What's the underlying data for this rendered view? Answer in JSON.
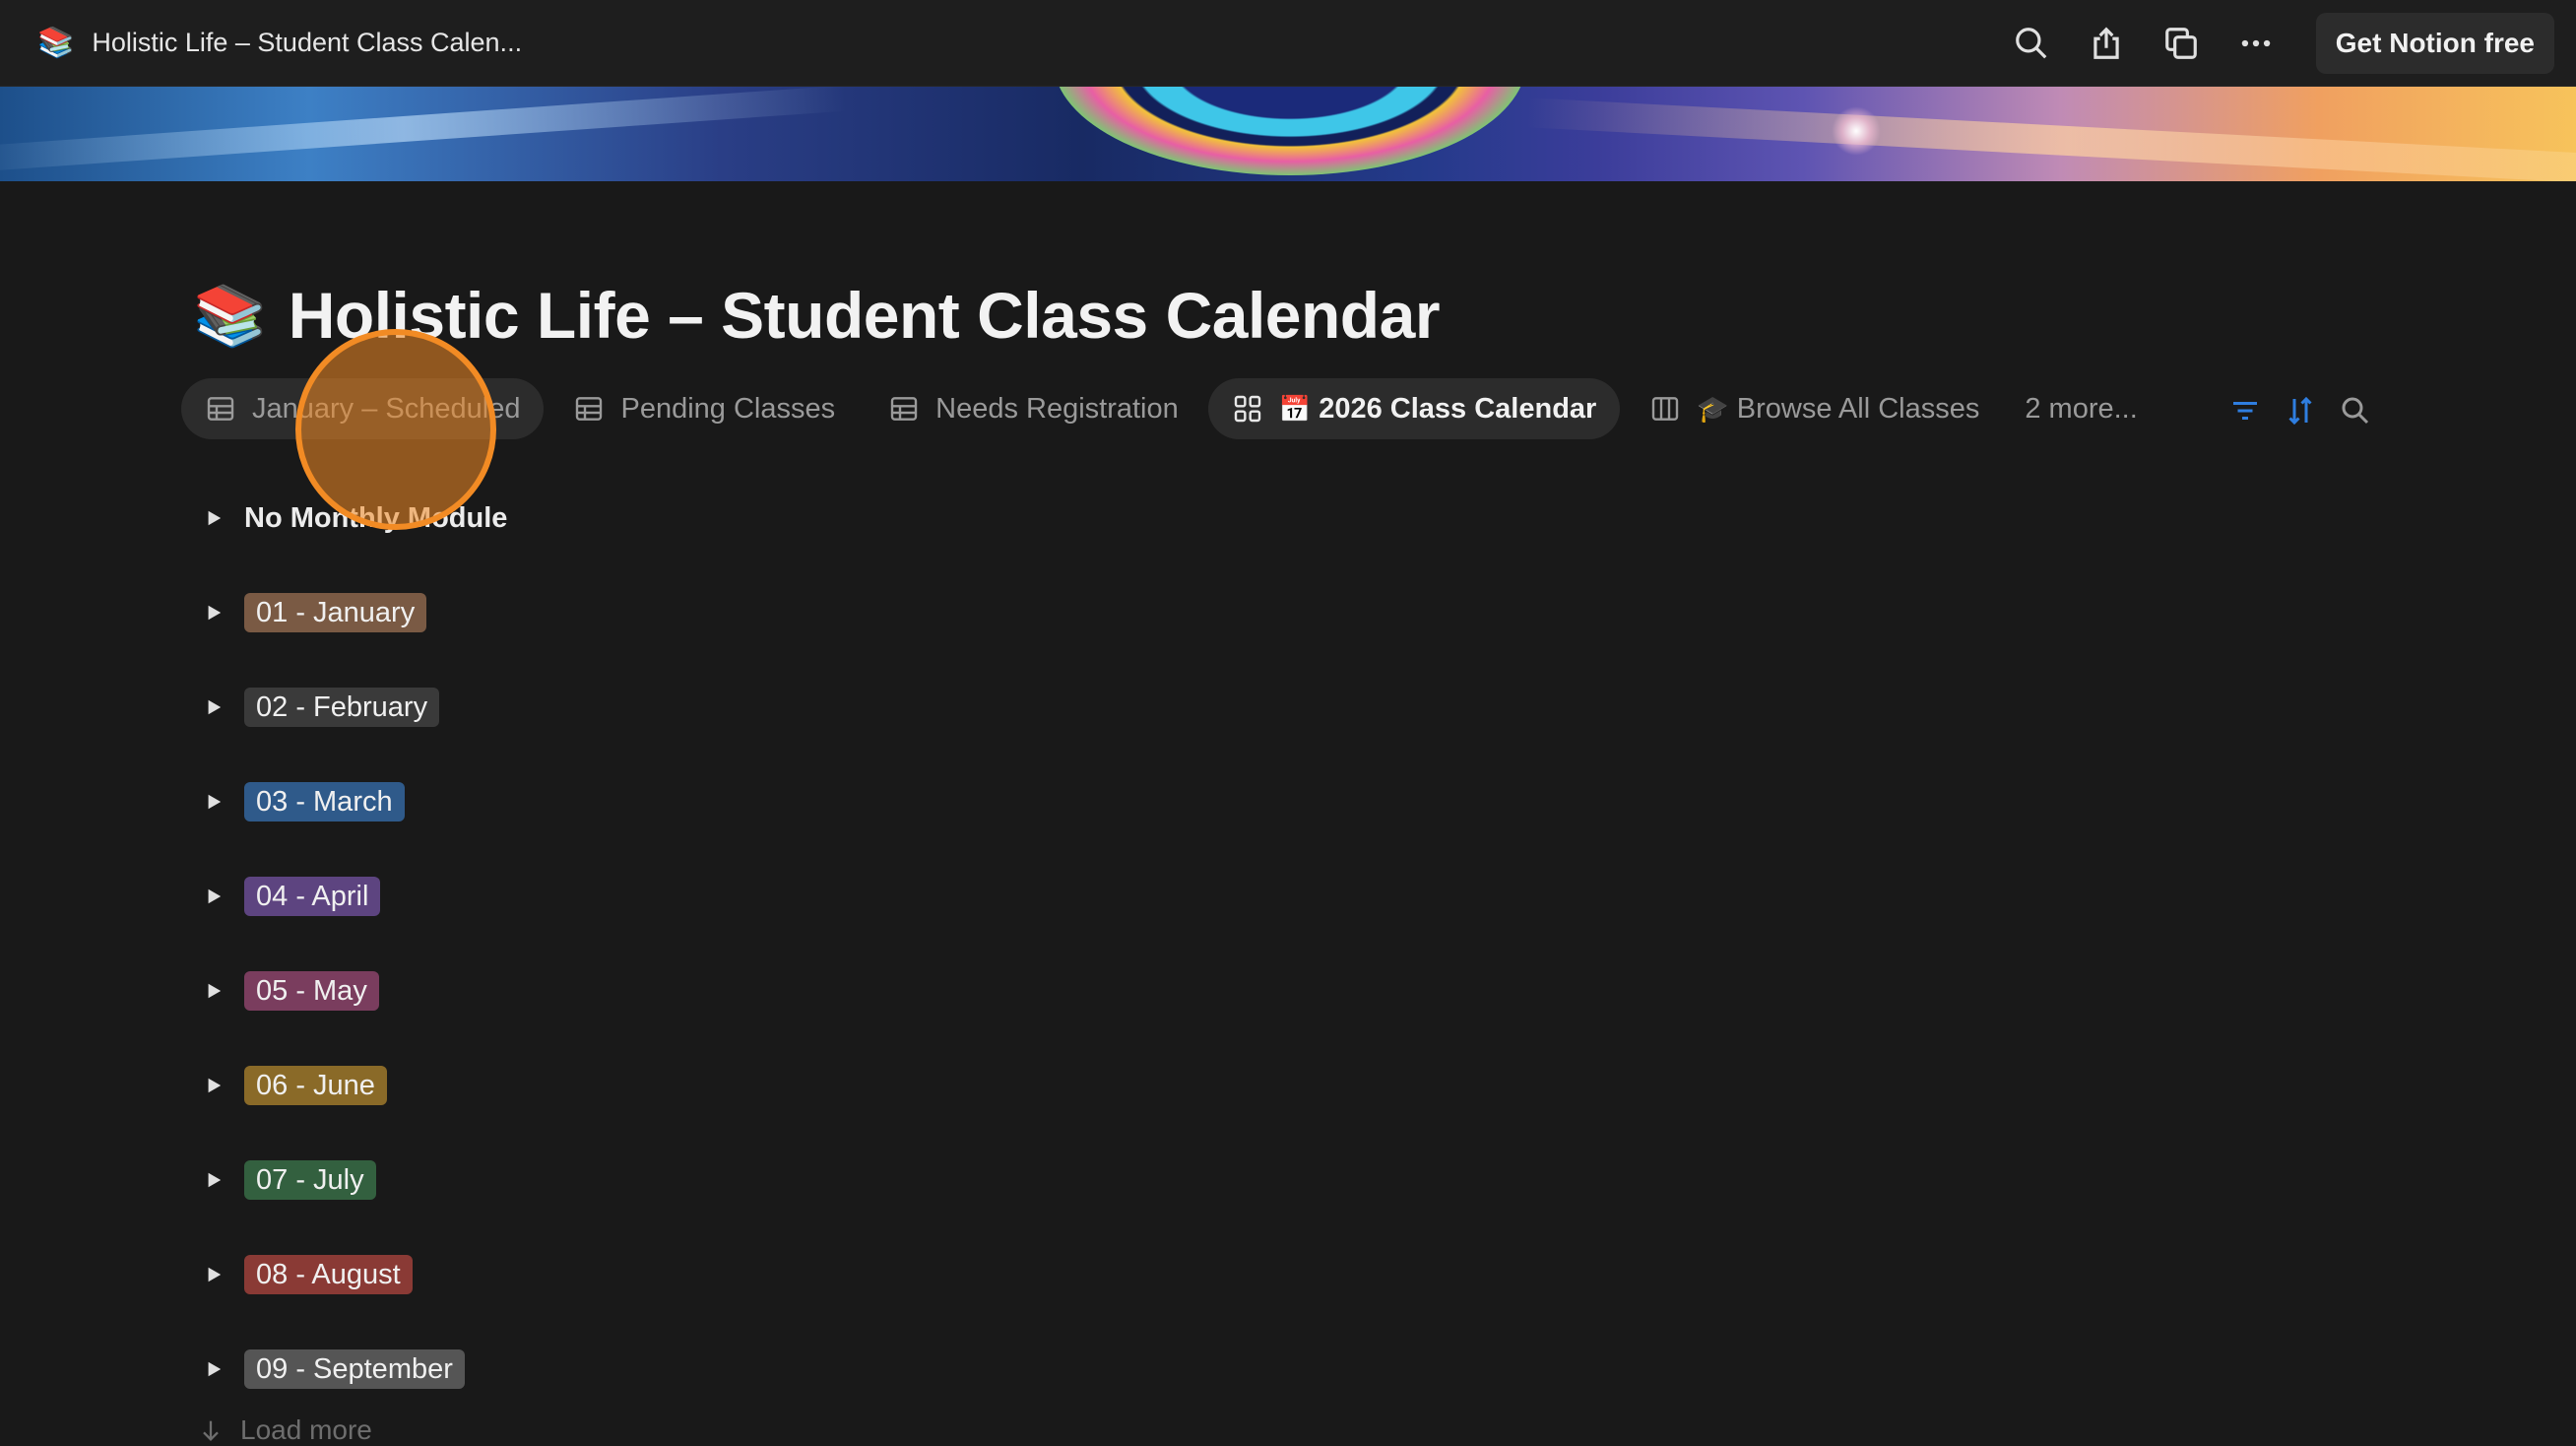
{
  "topbar": {
    "page_emoji": "📚",
    "page_title": "Holistic Life – Student Class Calen...",
    "get_notion_label": "Get Notion free",
    "icons": [
      "search-icon",
      "share-icon",
      "duplicate-icon",
      "more-icon"
    ]
  },
  "page": {
    "emoji": "📚",
    "title": "Holistic Life – Student Class Calendar"
  },
  "tabs": [
    {
      "label": "January – Scheduled",
      "icon": "table-icon"
    },
    {
      "label": "Pending Classes",
      "icon": "table-icon"
    },
    {
      "label": "Needs Registration",
      "icon": "table-icon"
    },
    {
      "label": "2026 Class Calendar",
      "icon": "gallery-icon",
      "emoji": "📅"
    },
    {
      "label": "Browse All Classes",
      "icon": "board-icon",
      "emoji": "🎓"
    },
    {
      "label": "2 more..."
    }
  ],
  "view_tools": [
    "filter-icon",
    "sort-icon",
    "search-icon"
  ],
  "groups": [
    {
      "label": "No Monthly Module",
      "color": ""
    },
    {
      "label": "01 - January",
      "color": "#7a5a44"
    },
    {
      "label": "02 - February",
      "color": "#3a3a3a"
    },
    {
      "label": "03 - March",
      "color": "#2f5a8a"
    },
    {
      "label": "04 - April",
      "color": "#5d4480"
    },
    {
      "label": "05 - May",
      "color": "#7a3d5e"
    },
    {
      "label": "06 - June",
      "color": "#8a6a28"
    },
    {
      "label": "07 - July",
      "color": "#33603f"
    },
    {
      "label": "08 - August",
      "color": "#8a3a35"
    },
    {
      "label": "09 - September",
      "color": "#555555"
    }
  ],
  "load_more_label": "Load more",
  "accent_color": "#2f7ee0"
}
